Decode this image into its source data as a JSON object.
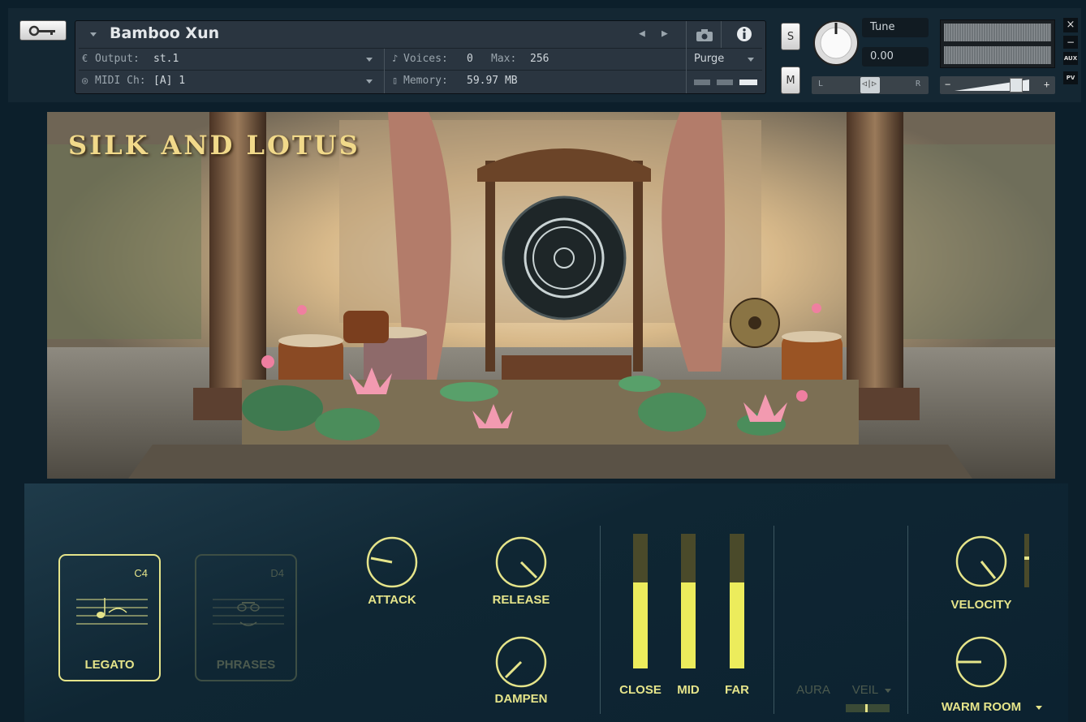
{
  "header": {
    "instrument_name": "Bamboo Xun",
    "output_label": "Output:",
    "output_value": "st.1",
    "midi_label": "MIDI Ch:",
    "midi_value": "[A] 1",
    "voices_label": "Voices:",
    "voices_value": "0",
    "max_label": "Max:",
    "max_value": "256",
    "memory_label": "Memory:",
    "memory_value": "59.97 MB",
    "purge_label": "Purge",
    "solo_label": "S",
    "mute_label": "M",
    "tune_label": "Tune",
    "tune_value": "0.00",
    "pan_left": "L",
    "pan_right": "R",
    "pan_center": "◁|▷",
    "close_label": "×",
    "minimize_label": "−",
    "aux_label": "AUX",
    "pv_label": "PV",
    "vol_minus": "−",
    "vol_plus": "+"
  },
  "hero": {
    "logo_text": "SILK AND LOTUS"
  },
  "panel": {
    "articulations": [
      {
        "name": "LEGATO",
        "key": "C4",
        "active": true
      },
      {
        "name": "PHRASES",
        "key": "D4",
        "active": false
      }
    ],
    "knobs": {
      "attack": "ATTACK",
      "release": "RELEASE",
      "dampen": "DAMPEN",
      "velocity": "VELOCITY"
    },
    "mics": [
      {
        "name": "CLOSE",
        "level": 0.64
      },
      {
        "name": "MID",
        "level": 0.64
      },
      {
        "name": "FAR",
        "level": 0.64
      }
    ],
    "aura_label": "AURA",
    "veil_label": "VEIL",
    "reverb_label": "WARM ROOM"
  },
  "colors": {
    "accent": "#e5e48a",
    "accent_dim": "#4c5a4e",
    "panel_bg": "#0f2633",
    "header_bg": "#142733"
  }
}
